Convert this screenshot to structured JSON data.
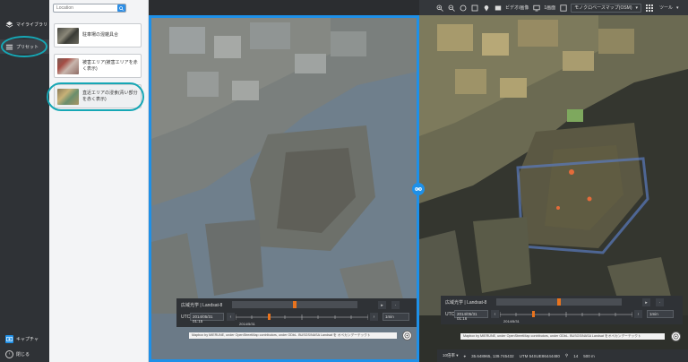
{
  "rail": {
    "my_layers_label": "マイライブラリ",
    "preset_label": "プリセット",
    "capture_label": "キャプチャ",
    "close_label": "閉じる"
  },
  "panel": {
    "search_placeholder": "Location",
    "presets": [
      {
        "label": "駐車場の混雑具合"
      },
      {
        "label": "被害エリア(被害エリアを赤く表示)"
      },
      {
        "label": "直近エリアの浸食(青い部分を赤く表示)"
      }
    ]
  },
  "topbar": {
    "media_label": "ビデオ/画像",
    "screen_label": "1画面",
    "basemap_label": "モノクロベースマップ(OSM)",
    "tools_label": "ツール"
  },
  "timebar_left": {
    "title": "広域光学 | Landsat-8",
    "utc_label": "UTC",
    "datetime": "2014/05/31 01:15",
    "date_small": "2014/5/31",
    "step": "1min"
  },
  "timebar_right": {
    "title": "広域光学 | Landsat-8",
    "utc_label": "UTC",
    "datetime": "2014/05/31 01:16",
    "date_small": "2014/5/31",
    "step": "1min"
  },
  "attribution": {
    "left": "Mapbox by MIERUNE, under OpenStreetMap contributors, under ODbL. BUSGS/NASA Landsat を オペカンデーテックト",
    "right": "Mapbox by MIERUNE, under OpenStreetMap contributors, under ODbL. BUSGS/NASA Landsat をオペカンデーテックト"
  },
  "status": {
    "zoom": "10倍率",
    "coords": "35.648965, 139.745432",
    "utm": "UTM 54SUE86444480",
    "zoom_level": "14",
    "scale": "500 m"
  }
}
